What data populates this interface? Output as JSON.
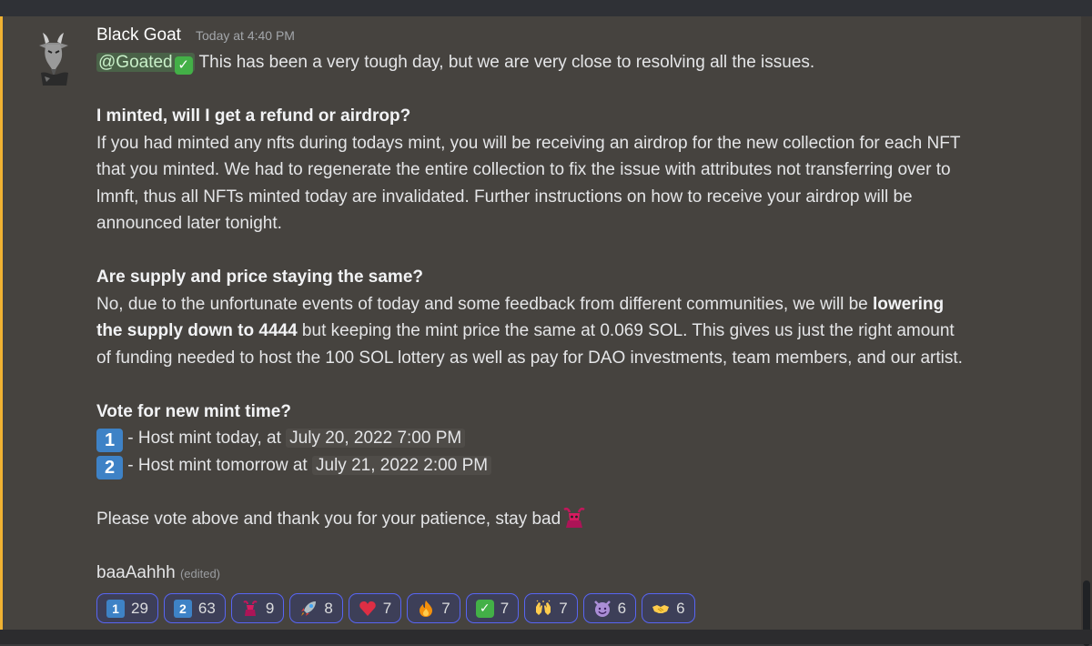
{
  "message": {
    "author": "Black Goat",
    "timestamp": "Today at 4:40 PM",
    "mention": "@Goated",
    "intro": " This has been a very tough day, but we are very close to resolving all the issues.",
    "section1": {
      "heading": "I minted, will I get a refund or airdrop?",
      "lines": [
        "If you had minted any nfts during todays mint, you will be receiving an airdrop for the new collection for each NFT",
        "that you minted. We had to regenerate the entire collection to fix the issue with attributes not transferring over to",
        "lmnft, thus all NFTs minted today are invalidated. Further instructions on how to receive your airdrop will be",
        "announced later tonight."
      ]
    },
    "section2": {
      "heading": "Are supply and price staying the same?",
      "line1": "No, due to the unfortunate events of today and some feedback from different communities, we will be ",
      "line1_bold": "lowering",
      "line2_bold": "the supply down to 4444",
      "line2": " but keeping the mint price the same at 0.069 SOL. This gives us just the right amount",
      "line3": "of funding needed to host the 100 SOL lottery as well as pay for DAO investments, team members, and our artist."
    },
    "section3": {
      "heading": "Vote for new mint time?",
      "option1_key": "1",
      "option1_text": " - Host mint today, at ",
      "option1_date": "July 20, 2022 7:00 PM",
      "option2_key": "2",
      "option2_text": " - Host mint tomorrow at ",
      "option2_date": "July 21, 2022 2:00 PM"
    },
    "closing": "Please vote above and thank you for your patience, stay bad",
    "signoff": "baaAahhh",
    "edited": "(edited)"
  },
  "reactions": [
    {
      "icon": "keycap-1-icon",
      "key": "1",
      "count": "29"
    },
    {
      "icon": "keycap-2-icon",
      "key": "2",
      "count": "63"
    },
    {
      "icon": "goat-icon",
      "count": "9"
    },
    {
      "icon": "rocket-icon",
      "count": "8"
    },
    {
      "icon": "heart-icon",
      "count": "7"
    },
    {
      "icon": "fire-icon",
      "count": "7"
    },
    {
      "icon": "check-icon",
      "key": "✓",
      "count": "7"
    },
    {
      "icon": "raised-hands-icon",
      "count": "7"
    },
    {
      "icon": "smiling-imp-icon",
      "count": "6"
    },
    {
      "icon": "handshake-icon",
      "count": "6"
    }
  ],
  "colors": {
    "accent": "#5865f2",
    "highlight_bar": "#f0b232",
    "message_bg": "#46433f"
  }
}
